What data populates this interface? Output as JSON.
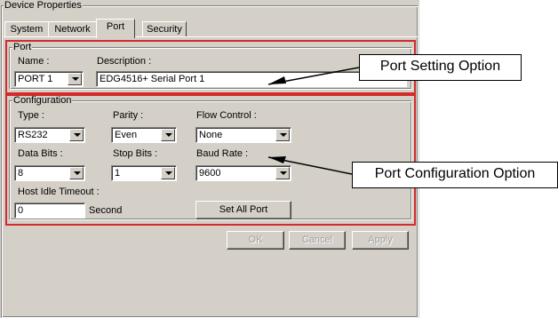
{
  "group_title": "Device Properties",
  "tabs": [
    {
      "label": "System"
    },
    {
      "label": "Network"
    },
    {
      "label": "Port"
    },
    {
      "label": "Security"
    }
  ],
  "port": {
    "group_title": "Port",
    "name_label": "Name :",
    "name_value": "PORT 1",
    "description_label": "Description :",
    "description_value": "EDG4516+ Serial Port 1"
  },
  "config": {
    "group_title": "Configuration",
    "type_label": "Type :",
    "type_value": "RS232",
    "parity_label": "Parity :",
    "parity_value": "Even",
    "flow_label": "Flow Control :",
    "flow_value": "None",
    "databits_label": "Data Bits :",
    "databits_value": "8",
    "stopbits_label": "Stop Bits :",
    "stopbits_value": "1",
    "baud_label": "Baud Rate :",
    "baud_value": "9600",
    "idle_label": "Host Idle Timeout :",
    "idle_value": "0",
    "idle_unit": "Second",
    "set_all_label": "Set All Port"
  },
  "buttons": {
    "ok": "OK",
    "cancel": "Cancel",
    "apply": "Apply"
  },
  "callouts": {
    "port_setting": "Port Setting Option",
    "port_config": "Port Configuration Option"
  },
  "colors": {
    "highlight_red": "#d42a2a",
    "dialog_bg": "#d4d0c8"
  }
}
